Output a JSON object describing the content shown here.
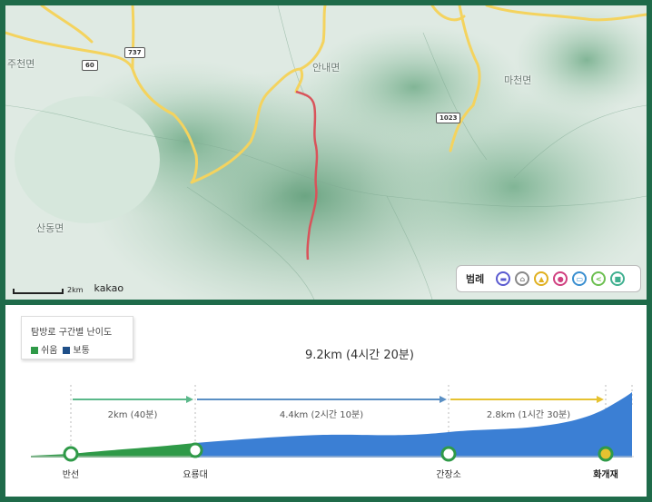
{
  "map": {
    "places": [
      "주천면",
      "안내면",
      "마천면",
      "산동면"
    ],
    "route_shields": [
      "737",
      "60",
      "1023"
    ],
    "scale_label": "2km",
    "brand": "kakao",
    "legend": {
      "title": "범례",
      "icons": [
        "bus-icon",
        "shelter-icon",
        "tent-icon",
        "person-icon",
        "car-icon",
        "share-icon",
        "lock-icon"
      ]
    },
    "colors": {
      "route": "#d9535a",
      "road": "#f4d35e",
      "terrain": "#8fbf9f"
    }
  },
  "profile": {
    "difficulty_title": "탐방로 구간별 난이도",
    "difficulty_easy": "쉬움",
    "difficulty_normal": "보통",
    "total": "9.2km (4시간 20분)",
    "segments": [
      {
        "label": "2km (40분)",
        "difficulty": "easy",
        "color": "#5bb88a"
      },
      {
        "label": "4.4km (2시간 10분)",
        "difficulty": "normal",
        "color": "#5a8fc4"
      },
      {
        "label": "2.8km (1시간 30분)",
        "difficulty": "normal",
        "color": "#e6c230"
      }
    ],
    "points": [
      "반선",
      "요룡대",
      "간장소",
      "화개재"
    ],
    "colors": {
      "easy": "#2f9a48",
      "normal": "#3b7fd4"
    }
  }
}
